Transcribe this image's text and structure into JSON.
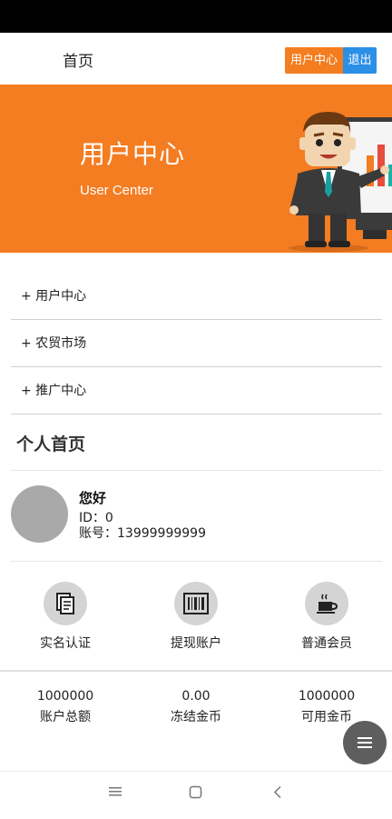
{
  "header": {
    "home_label": "首页",
    "user_center_button": "用户中心",
    "logout_button": "退出"
  },
  "banner": {
    "title": "用户中心",
    "subtitle": "User Center"
  },
  "menu": [
    {
      "label": "+ 用户中心"
    },
    {
      "label": "+ 农贸市场"
    },
    {
      "label": "+ 推广中心"
    }
  ],
  "section": {
    "title": "个人首页"
  },
  "profile": {
    "greeting": "您好",
    "id_text": "ID：0",
    "account_text": "账号：13999999999"
  },
  "functions": [
    {
      "label": "实名认证",
      "icon": "document-icon"
    },
    {
      "label": "提现账户",
      "icon": "barcode-icon"
    },
    {
      "label": "普通会员",
      "icon": "coffee-icon"
    }
  ],
  "stats": [
    {
      "value": "1000000",
      "label": "账户总额"
    },
    {
      "value": "0.00",
      "label": "冻结金币"
    },
    {
      "value": "1000000",
      "label": "可用金币"
    }
  ],
  "colors": {
    "accent_orange": "#f47d1f",
    "accent_blue": "#2b8fe6"
  }
}
